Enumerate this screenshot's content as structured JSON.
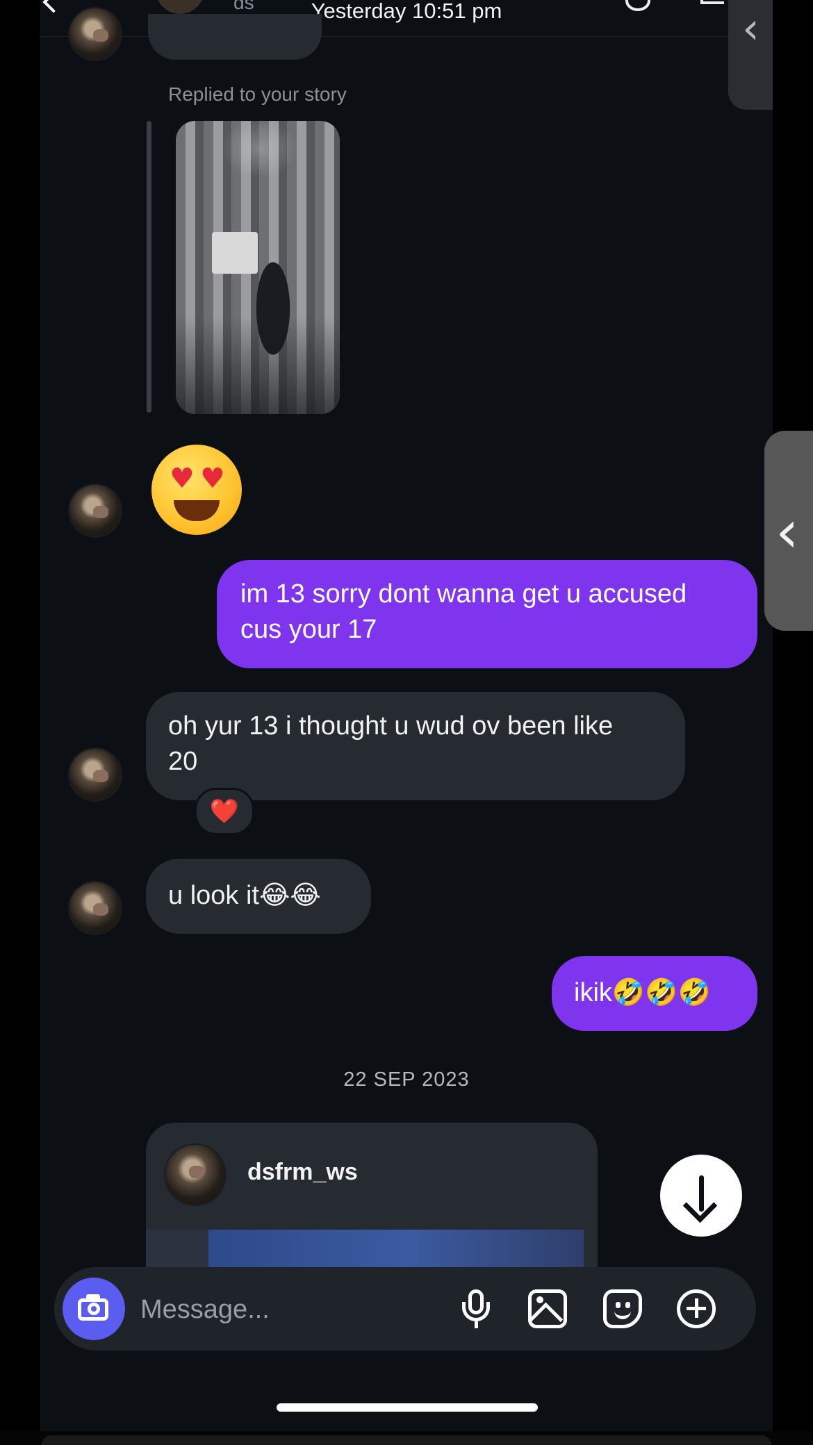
{
  "header": {
    "title": "Yesterday 10:51 pm",
    "contact_name_fragment": "ds"
  },
  "story_reply": {
    "label": "Replied to your story"
  },
  "messages": [
    {
      "from": "them",
      "text": "😍"
    },
    {
      "from": "me",
      "line1": "im 13 sorry dont wanna get u accused",
      "line2": "cus your 17"
    },
    {
      "from": "them",
      "line1": "oh yur 13 i thought u wud ov been like",
      "line2": "20",
      "reaction": "❤️"
    },
    {
      "from": "them",
      "text": "u look it😂😂"
    },
    {
      "from": "me",
      "text": "ikik🤣🤣🤣"
    }
  ],
  "date_separator": "22 SEP 2023",
  "shared_post": {
    "username": "dsfrm_ws"
  },
  "composer": {
    "placeholder": "Message..."
  },
  "icons": {
    "camera": "camera-icon",
    "mic": "microphone-icon",
    "gallery": "gallery-icon",
    "sticker": "sticker-icon",
    "plus": "plus-circle-icon",
    "scroll": "arrow-down-icon"
  },
  "colors": {
    "background": "#0c0f14",
    "sent_bubble": "#7f35ee",
    "received_bubble": "#262a31",
    "camera_button": "#5b5cf0"
  }
}
